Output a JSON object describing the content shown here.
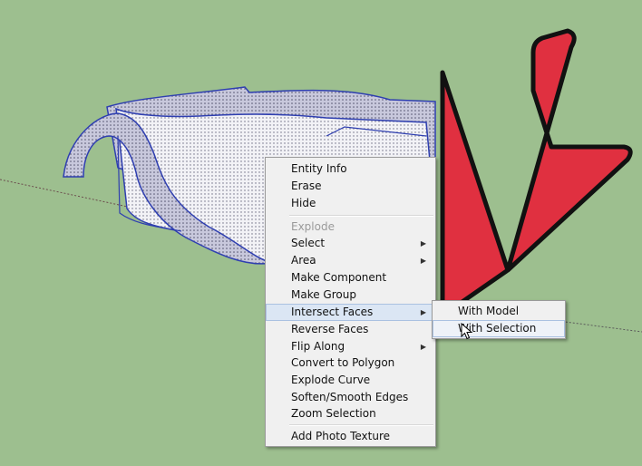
{
  "context_menu": {
    "items": [
      {
        "label": "Entity Info"
      },
      {
        "label": "Erase"
      },
      {
        "label": "Hide"
      },
      {
        "label": "Explode"
      },
      {
        "label": "Select"
      },
      {
        "label": "Area"
      },
      {
        "label": "Make Component"
      },
      {
        "label": "Make Group"
      },
      {
        "label": "Intersect Faces"
      },
      {
        "label": "Reverse Faces"
      },
      {
        "label": "Flip Along"
      },
      {
        "label": "Convert to Polygon"
      },
      {
        "label": "Explode Curve"
      },
      {
        "label": "Soften/Smooth Edges"
      },
      {
        "label": "Zoom Selection"
      },
      {
        "label": "Add Photo Texture"
      }
    ]
  },
  "submenu": {
    "items": [
      {
        "label": "With Model"
      },
      {
        "label": "With Selection"
      }
    ]
  },
  "colors": {
    "canvas_background": "#9dbf8f",
    "pointer_arrow": "#e03040",
    "selection_edges": "#2f3fb0",
    "menu_highlight": "#dbe6f4"
  },
  "icons": {
    "pointer": "red-arrow-icon",
    "cursor": "mouse-cursor-icon",
    "submenu_indicator": "chevron-right-icon"
  }
}
